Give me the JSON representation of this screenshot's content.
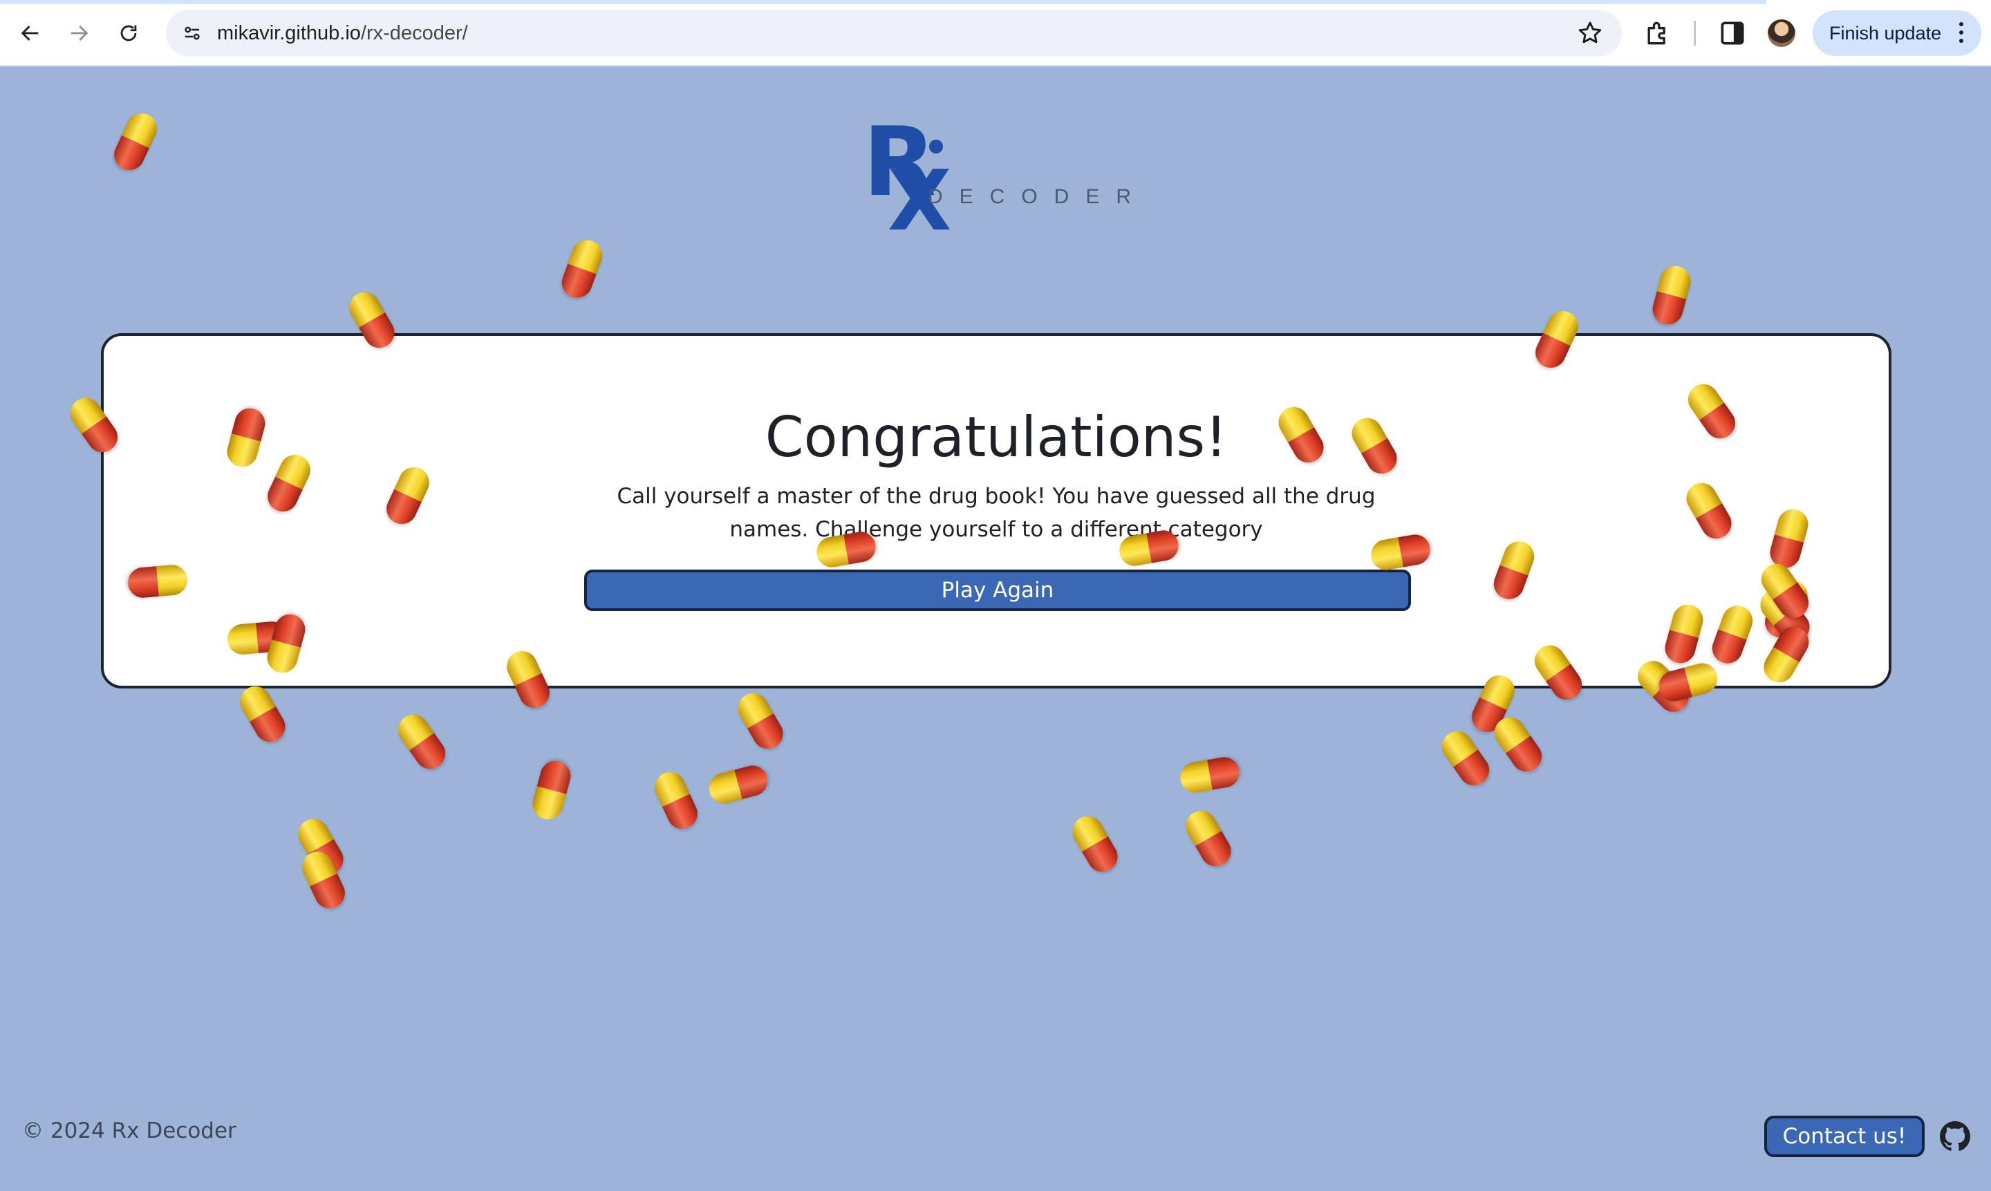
{
  "browser": {
    "url_host": "mikavir.github.io",
    "url_path": "/rx-decoder/",
    "finish_update_label": "Finish update",
    "icons": [
      "back-arrow-icon",
      "forward-arrow-icon",
      "reload-icon",
      "site-info-icon",
      "bookmark-star-icon",
      "extensions-icon",
      "side-panel-icon",
      "profile-avatar",
      "more-menu-icon"
    ]
  },
  "logo": {
    "mark_r": "R",
    "mark_x": "X",
    "wordmark": "DECODER"
  },
  "card": {
    "title": "Congratulations!",
    "message_line1": "Call yourself a master of the drug book! You have guessed all the drug",
    "message_line2": "names. Challenge yourself to a different category",
    "play_again_label": "Play Again"
  },
  "footer": {
    "copyright": "© 2024 Rx Decoder",
    "contact_label": "Contact us!",
    "github_icon": "github-icon"
  },
  "confetti": {
    "type": "pill-capsules",
    "colors": [
      "#f3d22a",
      "#df4128"
    ],
    "count": 45
  }
}
